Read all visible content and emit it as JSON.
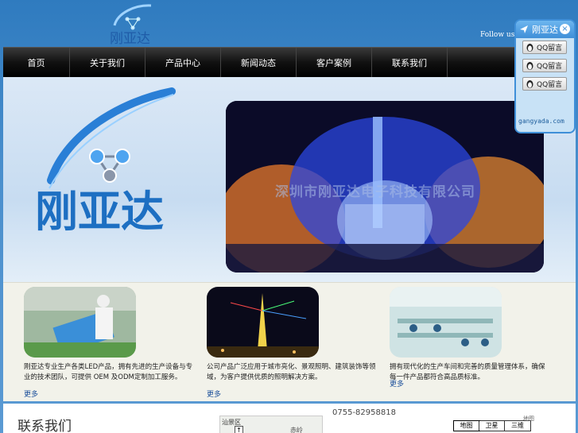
{
  "header": {
    "follow_text": "Follow us"
  },
  "nav": {
    "items": [
      {
        "label": "首页"
      },
      {
        "label": "关于我们"
      },
      {
        "label": "产品中心"
      },
      {
        "label": "新闻动态"
      },
      {
        "label": "客户案例"
      },
      {
        "label": "联系我们"
      }
    ]
  },
  "banner": {
    "brand_text": "刚亚达",
    "watermark": "深圳市刚亚达电子科技有限公司"
  },
  "cards": [
    {
      "text": "刚亚达专业生产各类LED产品，拥有先进的生产设备与专业的技术团队，可提供 OEM 及ODM定制加工服务。",
      "more": "更多"
    },
    {
      "text": "公司产品广泛应用于城市亮化、景观照明、建筑装饰等领域，为客户提供优质的照明解决方案。",
      "more": "更多"
    },
    {
      "text": "拥有现代化的生产车间和完善的质量管理体系，确保每一件产品都符合高品质标准。",
      "more": "更多"
    }
  ],
  "bottom": {
    "title": "联系我们",
    "phone": "0755-82958818",
    "map_label": "汕景区",
    "map_label2": "赤岭",
    "buttons": [
      "地图",
      "卫星",
      "三维"
    ],
    "corner_note": "地图"
  },
  "qq": {
    "title": "刚亚达",
    "close": "×",
    "buttons": [
      "QQ留言",
      "QQ留言",
      "QQ留言"
    ],
    "site": "gangyada.com"
  },
  "colors": {
    "nav_bg": "#111111",
    "page_bg": "#4a8fcd",
    "accent": "#3f8fd8"
  }
}
